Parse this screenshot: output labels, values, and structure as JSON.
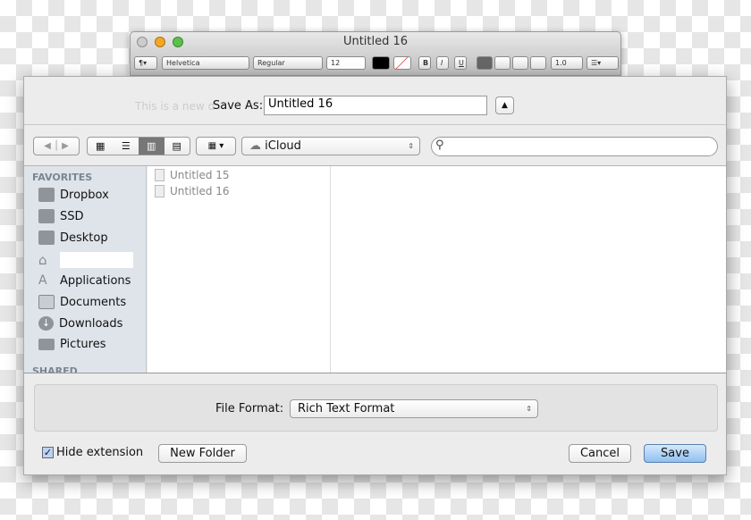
{
  "window": {
    "title": "Untitled 16",
    "toolbar": {
      "paragraph": "¶▾",
      "font": "Helvetica",
      "style": "Regular",
      "size": "12",
      "bold": "B",
      "italic": "I",
      "underline": "U",
      "spacing": "1.0",
      "list": "☰▾"
    },
    "doc_text": "This is a new d"
  },
  "dialog": {
    "save_as_label": "Save As:",
    "save_as_value": "Untitled 16",
    "location": "iCloud",
    "search_placeholder": "",
    "sidebar": {
      "favorites_header": "FAVORITES",
      "shared_header": "SHARED",
      "items": [
        {
          "label": "Dropbox",
          "icon": "folder-icon"
        },
        {
          "label": "SSD",
          "icon": "drive-icon"
        },
        {
          "label": "Desktop",
          "icon": "desktop-icon"
        },
        {
          "label": "",
          "icon": "home-icon"
        },
        {
          "label": "Applications",
          "icon": "applications-icon"
        },
        {
          "label": "Documents",
          "icon": "documents-icon"
        },
        {
          "label": "Downloads",
          "icon": "downloads-icon"
        },
        {
          "label": "Pictures",
          "icon": "pictures-icon"
        }
      ]
    },
    "files": [
      "Untitled 15",
      "Untitled 16"
    ],
    "file_format_label": "File Format:",
    "file_format_value": "Rich Text Format",
    "hide_extension_label": "Hide extension",
    "hide_extension_checked": true,
    "new_folder": "New Folder",
    "cancel": "Cancel",
    "save": "Save"
  }
}
